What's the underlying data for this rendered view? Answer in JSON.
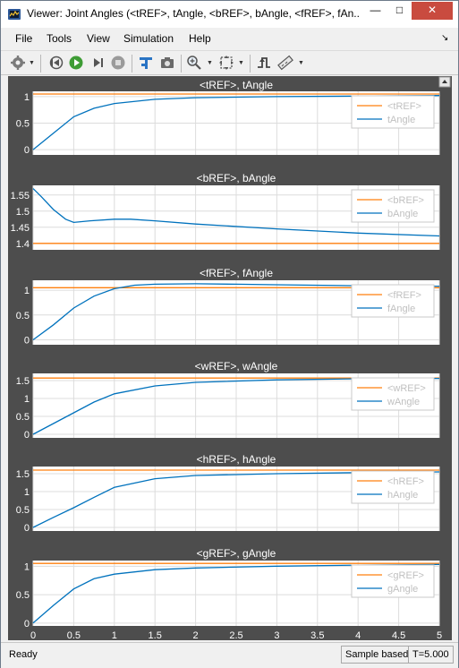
{
  "window": {
    "title": "Viewer: Joint Angles (<tREF>, tAngle, <bREF>, bAngle, <fREF>, fAn...",
    "minimize_glyph": "—",
    "maximize_glyph": "□",
    "close_glyph": "✕"
  },
  "menu": [
    "File",
    "Tools",
    "View",
    "Simulation",
    "Help"
  ],
  "menu_corner_glyph": "↘",
  "status": {
    "ready": "Ready",
    "mode": "Sample based",
    "time": "T=5.000"
  },
  "colors": {
    "plot_bg": "#4d4d4d",
    "axes_bg": "#ffffff",
    "grid": "#dcdcdc",
    "reference_line": "#ff7f0e",
    "signal_line": "#0072bd",
    "title_text": "#ffffff",
    "tick_text": "#ffffff",
    "legend_text": "#c0c0c0"
  },
  "chart_data": [
    {
      "type": "line",
      "title": "<tREF>, tAngle",
      "xlim": [
        0,
        5
      ],
      "ylim": [
        -0.1,
        1.1
      ],
      "yticks": [
        "0",
        "0.5",
        "1"
      ],
      "ytick_values": [
        0,
        0.5,
        1
      ],
      "legend": "top-right",
      "series": [
        {
          "name": "<tREF>",
          "x": [
            0,
            5
          ],
          "values": [
            1.05,
            1.05
          ]
        },
        {
          "name": "tAngle",
          "x": [
            0,
            0.25,
            0.5,
            0.75,
            1.0,
            1.5,
            2.0,
            3.0,
            4.0,
            5.0
          ],
          "values": [
            0,
            0.31,
            0.62,
            0.78,
            0.87,
            0.95,
            0.98,
            1.0,
            1.01,
            1.02
          ]
        }
      ]
    },
    {
      "type": "line",
      "title": "<bREF>, bAngle",
      "xlim": [
        0,
        5
      ],
      "ylim": [
        1.38,
        1.58
      ],
      "yticks": [
        "1.4",
        "1.45",
        "1.5",
        "1.55"
      ],
      "ytick_values": [
        1.4,
        1.45,
        1.5,
        1.55
      ],
      "legend": "top-right",
      "series": [
        {
          "name": "<bREF>",
          "x": [
            0,
            5
          ],
          "values": [
            1.4,
            1.4
          ]
        },
        {
          "name": "bAngle",
          "x": [
            0,
            0.1,
            0.25,
            0.4,
            0.5,
            0.7,
            1.0,
            1.2,
            1.5,
            2.0,
            3.0,
            4.0,
            5.0
          ],
          "values": [
            1.57,
            1.545,
            1.505,
            1.475,
            1.465,
            1.47,
            1.475,
            1.475,
            1.47,
            1.46,
            1.445,
            1.432,
            1.423
          ]
        }
      ]
    },
    {
      "type": "line",
      "title": "<fREF>, fAngle",
      "xlim": [
        0,
        5
      ],
      "ylim": [
        -0.1,
        1.2
      ],
      "yticks": [
        "0",
        "0.5",
        "1"
      ],
      "ytick_values": [
        0,
        0.5,
        1
      ],
      "legend": "top-right",
      "series": [
        {
          "name": "<fREF>",
          "x": [
            0,
            5
          ],
          "values": [
            1.05,
            1.05
          ]
        },
        {
          "name": "fAngle",
          "x": [
            0,
            0.25,
            0.5,
            0.75,
            1.0,
            1.25,
            1.5,
            2.0,
            2.5,
            3.0,
            4.0,
            5.0
          ],
          "values": [
            0,
            0.3,
            0.64,
            0.88,
            1.03,
            1.1,
            1.12,
            1.13,
            1.12,
            1.11,
            1.09,
            1.08
          ]
        }
      ]
    },
    {
      "type": "line",
      "title": "<wREF>, wAngle",
      "xlim": [
        0,
        5
      ],
      "ylim": [
        -0.1,
        1.7
      ],
      "yticks": [
        "0",
        "0.5",
        "1",
        "1.5"
      ],
      "ytick_values": [
        0,
        0.5,
        1,
        1.5
      ],
      "legend": "top-right",
      "series": [
        {
          "name": "<wREF>",
          "x": [
            0,
            5
          ],
          "values": [
            1.57,
            1.57
          ]
        },
        {
          "name": "wAngle",
          "x": [
            0,
            0.25,
            0.5,
            0.75,
            1.0,
            1.5,
            2.0,
            3.0,
            4.0,
            5.0
          ],
          "values": [
            0,
            0.3,
            0.6,
            0.9,
            1.13,
            1.35,
            1.45,
            1.52,
            1.55,
            1.56
          ]
        }
      ]
    },
    {
      "type": "line",
      "title": "<hREF>, hAngle",
      "xlim": [
        0,
        5
      ],
      "ylim": [
        -0.1,
        1.7
      ],
      "yticks": [
        "0",
        "0.5",
        "1",
        "1.5"
      ],
      "ytick_values": [
        0,
        0.5,
        1,
        1.5
      ],
      "legend": "top-right",
      "series": [
        {
          "name": "<hREF>",
          "x": [
            0,
            5
          ],
          "values": [
            1.6,
            1.6
          ]
        },
        {
          "name": "hAngle",
          "x": [
            0,
            0.25,
            0.5,
            0.75,
            1.0,
            1.5,
            2.0,
            3.0,
            4.0,
            5.0
          ],
          "values": [
            0,
            0.28,
            0.55,
            0.84,
            1.12,
            1.36,
            1.45,
            1.5,
            1.53,
            1.55
          ]
        }
      ]
    },
    {
      "type": "line",
      "title": "<gREF>, gAngle",
      "xlim": [
        0,
        5
      ],
      "ylim": [
        -0.05,
        1.1
      ],
      "yticks": [
        "0",
        "0.5",
        "1"
      ],
      "ytick_values": [
        0,
        0.5,
        1
      ],
      "xticks": [
        "0",
        "0.5",
        "1",
        "1.5",
        "2",
        "2.5",
        "3",
        "3.5",
        "4",
        "4.5",
        "5"
      ],
      "legend": "top-right",
      "series": [
        {
          "name": "<gREF>",
          "x": [
            0,
            5
          ],
          "values": [
            1.05,
            1.05
          ]
        },
        {
          "name": "gAngle",
          "x": [
            0,
            0.25,
            0.5,
            0.75,
            1.0,
            1.5,
            2.0,
            3.0,
            4.0,
            5.0
          ],
          "values": [
            0,
            0.31,
            0.6,
            0.78,
            0.86,
            0.94,
            0.97,
            1.0,
            1.02,
            1.03
          ]
        }
      ]
    }
  ]
}
